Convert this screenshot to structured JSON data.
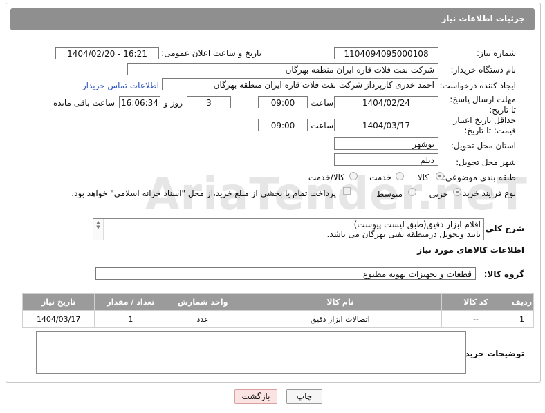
{
  "header": {
    "title": "جزئیات اطلاعات نیاز"
  },
  "watermark": "AriaTender.neT",
  "form": {
    "need_number": {
      "label": "شماره نیاز:",
      "value": "1104094095000108"
    },
    "announce_datetime": {
      "label": "تاریخ و ساعت اعلان عمومی:",
      "value": "1404/02/20 - 16:21"
    },
    "buyer_org": {
      "label": "نام دستگاه خریدار:",
      "value": "شرکت نفت فلات قاره ایران منطقه بهرگان"
    },
    "creator": {
      "label": "ایجاد کننده درخواست:",
      "value": "احمد خدری کارپرداز شرکت نفت فلات قاره ایران منطقه بهرگان",
      "contact_link": "اطلاعات تماس خریدار"
    },
    "reply_deadline": {
      "label": "مهلت ارسال پاسخ: تا تاریخ:",
      "date": "1404/02/24",
      "time_label": "ساعت",
      "time": "09:00",
      "days": "3",
      "days_label": "روز و",
      "remaining": "16:06:34",
      "remaining_label": "ساعت باقی مانده"
    },
    "price_validity": {
      "label": "حداقل تاریخ اعتبار قیمت: تا تاریخ:",
      "date": "1404/03/17",
      "time_label": "ساعت",
      "time": "09:00"
    },
    "delivery_province": {
      "label": "استان محل تحویل:",
      "value": "بوشهر"
    },
    "delivery_city": {
      "label": "شهر محل تحویل:",
      "value": "دیلم"
    },
    "category": {
      "label": "طبقه بندی موضوعی:",
      "options": [
        "کالا",
        "خدمت",
        "کالا/خدمت"
      ],
      "selected": "کالا"
    },
    "purchase_type": {
      "label": "نوع فرآیند خرید :",
      "options": [
        "جزیی",
        "متوسط"
      ],
      "selected": "جزیی",
      "payment_note": "پرداخت تمام یا بخشی از مبلغ خرید،از محل \"اسناد خزانه اسلامی\" خواهد بود."
    }
  },
  "description": {
    "label": "شرح کلی نیاز:",
    "line1": "اقلام ابزار دقیق(طبق لیست پیوست)",
    "line2": "تایید وتحویل درمنطقه نفتی بهرگان می باشد."
  },
  "items_section": {
    "title": "اطلاعات کالاهای مورد نیاز",
    "group_label": "گروه کالا:",
    "group_value": "قطعات و تجهیزات تهویه مطبوع"
  },
  "table": {
    "headers": [
      "ردیف",
      "کد کالا",
      "نام کالا",
      "واحد شمارش",
      "تعداد / مقدار",
      "تاریخ نیاز"
    ],
    "rows": [
      [
        "1",
        "--",
        "اتصالات ابزار دقیق",
        "عدد",
        "1",
        "1404/03/17"
      ]
    ]
  },
  "buyer_notes": {
    "label": "توضیحات خریدار:",
    "value": ""
  },
  "buttons": {
    "print": "چاپ",
    "back": "بازگشت"
  }
}
